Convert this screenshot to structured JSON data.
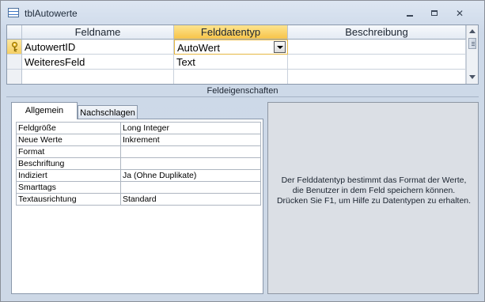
{
  "window": {
    "title": "tblAutowerte",
    "icon": "table-icon"
  },
  "grid": {
    "headers": [
      "Feldname",
      "Felddatentyp",
      "Beschreibung"
    ],
    "rows": [
      {
        "name": "AutowertID",
        "type": "AutoWert",
        "desc": "",
        "primary_key": true
      },
      {
        "name": "WeiteresFeld",
        "type": "Text",
        "desc": ""
      },
      {
        "name": "",
        "type": "",
        "desc": ""
      }
    ]
  },
  "section_label": "Feldeigenschaften",
  "tabs": {
    "general": "Allgemein",
    "lookup": "Nachschlagen"
  },
  "properties": [
    {
      "key": "Feldgröße",
      "value": "Long Integer"
    },
    {
      "key": "Neue Werte",
      "value": "Inkrement"
    },
    {
      "key": "Format",
      "value": ""
    },
    {
      "key": "Beschriftung",
      "value": ""
    },
    {
      "key": "Indiziert",
      "value": "Ja (Ohne Duplikate)"
    },
    {
      "key": "Smarttags",
      "value": ""
    },
    {
      "key": "Textausrichtung",
      "value": "Standard"
    }
  ],
  "help_text": "Der Felddatentyp bestimmt das Format der Werte, die Benutzer in dem Feld speichern können. Drücken Sie F1, um Hilfe zu Datentypen zu erhalten.",
  "colors": {
    "active_header": "#f7c44a",
    "panel_bg": "#cdd9e9",
    "help_bg": "#dbdfe5"
  }
}
